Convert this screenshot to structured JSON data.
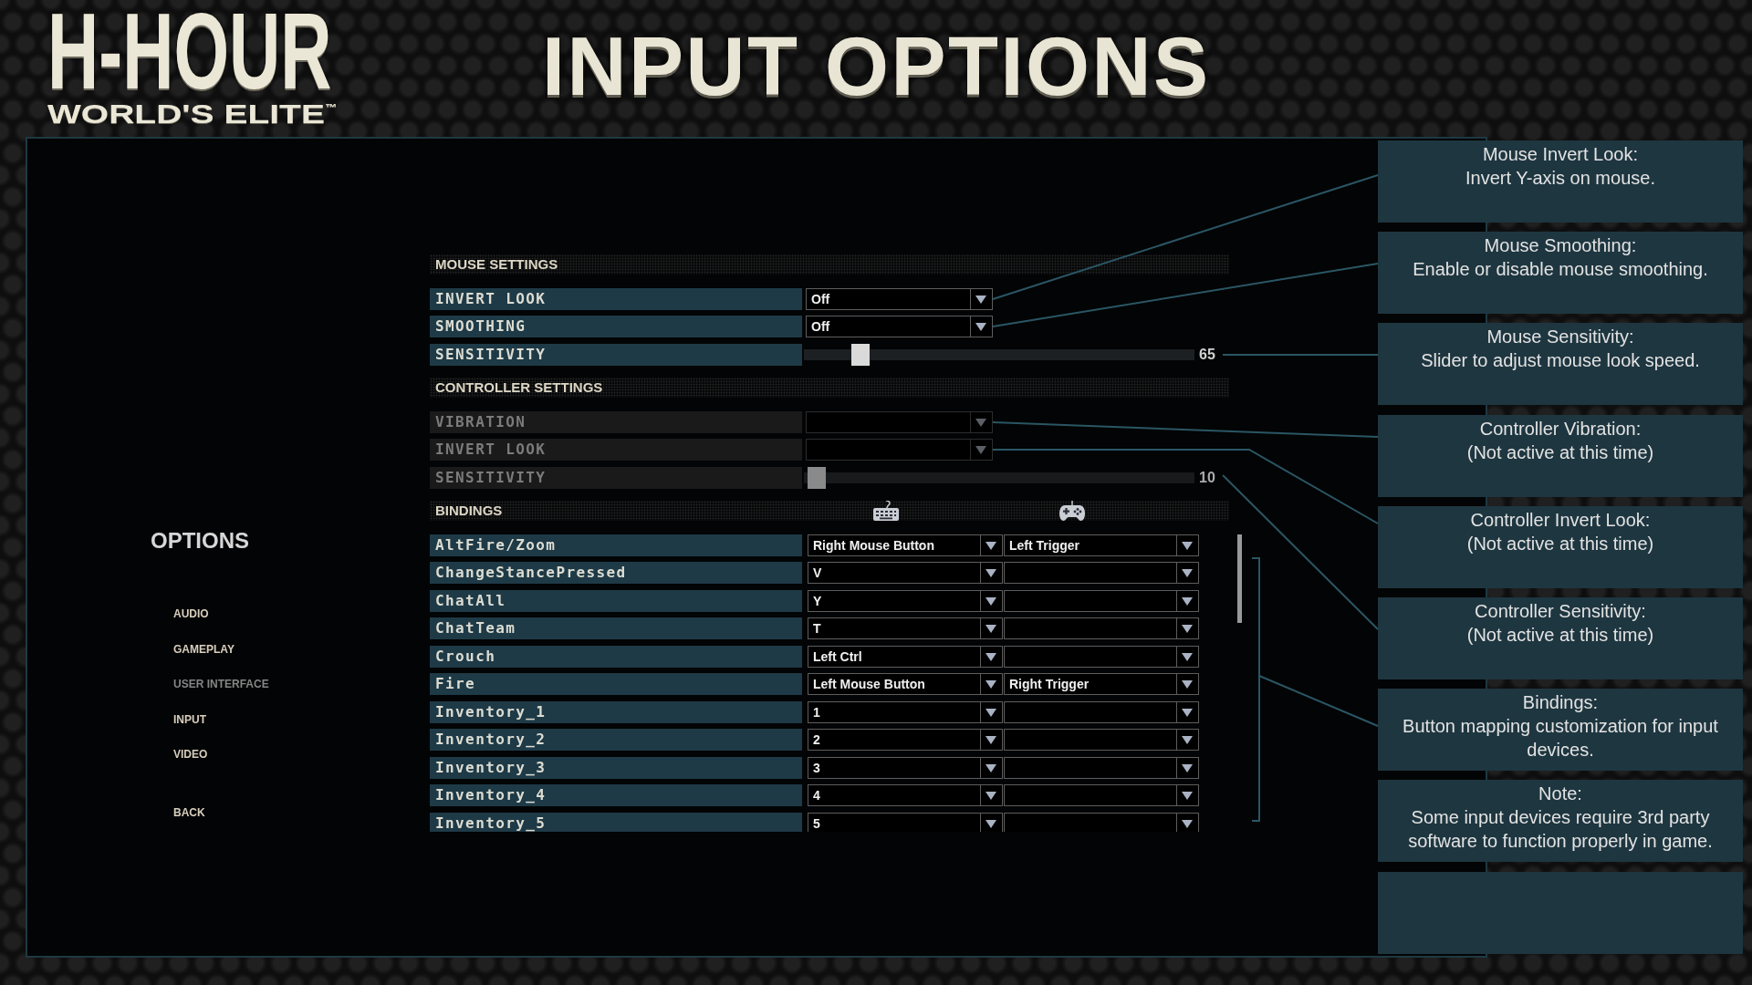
{
  "logo": {
    "wordmark": "H-HOUR",
    "tagline": "WORLD'S ELITE$^{™}$"
  },
  "title": "INPUT OPTIONS",
  "menu": {
    "heading": "OPTIONS",
    "items": [
      {
        "label": "AUDIO",
        "disabled": false
      },
      {
        "label": "GAMEPLAY",
        "disabled": false
      },
      {
        "label": "USER INTERFACE",
        "disabled": true
      },
      {
        "label": "INPUT",
        "disabled": false
      },
      {
        "label": "VIDEO",
        "disabled": false
      }
    ],
    "back": "BACK"
  },
  "sections": [
    {
      "title": "MOUSE SETTINGS",
      "rows": [
        {
          "label": "INVERT LOOK",
          "kind": "dropdown",
          "disabled": false,
          "value": "Off"
        },
        {
          "label": "SMOOTHING",
          "kind": "dropdown",
          "disabled": false,
          "value": "Off"
        },
        {
          "label": "SENSITIVITY",
          "kind": "slider",
          "disabled": false,
          "level": 0.12,
          "reading": "65"
        }
      ]
    },
    {
      "title": "CONTROLLER SETTINGS",
      "rows": [
        {
          "label": "VIBRATION",
          "kind": "dropdown",
          "disabled": true
        },
        {
          "label": "INVERT LOOK",
          "kind": "dropdown",
          "disabled": true
        },
        {
          "label": "SENSITIVITY",
          "kind": "slider",
          "disabled": true,
          "level": 0,
          "reading": "10"
        }
      ]
    }
  ],
  "bindings": {
    "title": "BINDINGS",
    "rows": [
      {
        "action": "AltFire/Zoom",
        "keyboard": "Right Mouse Button",
        "controller": "Left Trigger"
      },
      {
        "action": "ChangeStancePressed",
        "keyboard": "V"
      },
      {
        "action": "ChatAll",
        "keyboard": "Y"
      },
      {
        "action": "ChatTeam",
        "keyboard": "T"
      },
      {
        "action": "Crouch",
        "keyboard": "Left Ctrl"
      },
      {
        "action": "Fire",
        "keyboard": "Left Mouse Button",
        "controller": "Right Trigger"
      },
      {
        "action": "Inventory_1",
        "keyboard": "1"
      },
      {
        "action": "Inventory_2",
        "keyboard": "2"
      },
      {
        "action": "Inventory_3",
        "keyboard": "3"
      },
      {
        "action": "Inventory_4",
        "keyboard": "4"
      },
      {
        "action": "Inventory_5",
        "keyboard": "5"
      }
    ]
  },
  "help_panels": [
    {
      "title": "Mouse Invert Look:",
      "text": "Invert Y-axis on mouse."
    },
    {
      "title": "Mouse Smoothing:",
      "text": "Enable or disable mouse smoothing."
    },
    {
      "title": "Mouse Sensitivity:",
      "text": "Slider to adjust mouse look speed."
    },
    {
      "title": "Controller Vibration:",
      "text": "(Not active at this time)"
    },
    {
      "title": "Controller Invert Look:",
      "text": "(Not active at this time)"
    },
    {
      "title": "Controller Sensitivity:",
      "text": "(Not active at this time)"
    },
    {
      "title": "Bindings:",
      "text": "Button mapping customization for input devices."
    },
    {
      "title": "Note:",
      "text": "Some input devices require 3rd party software to function properly in game."
    }
  ]
}
